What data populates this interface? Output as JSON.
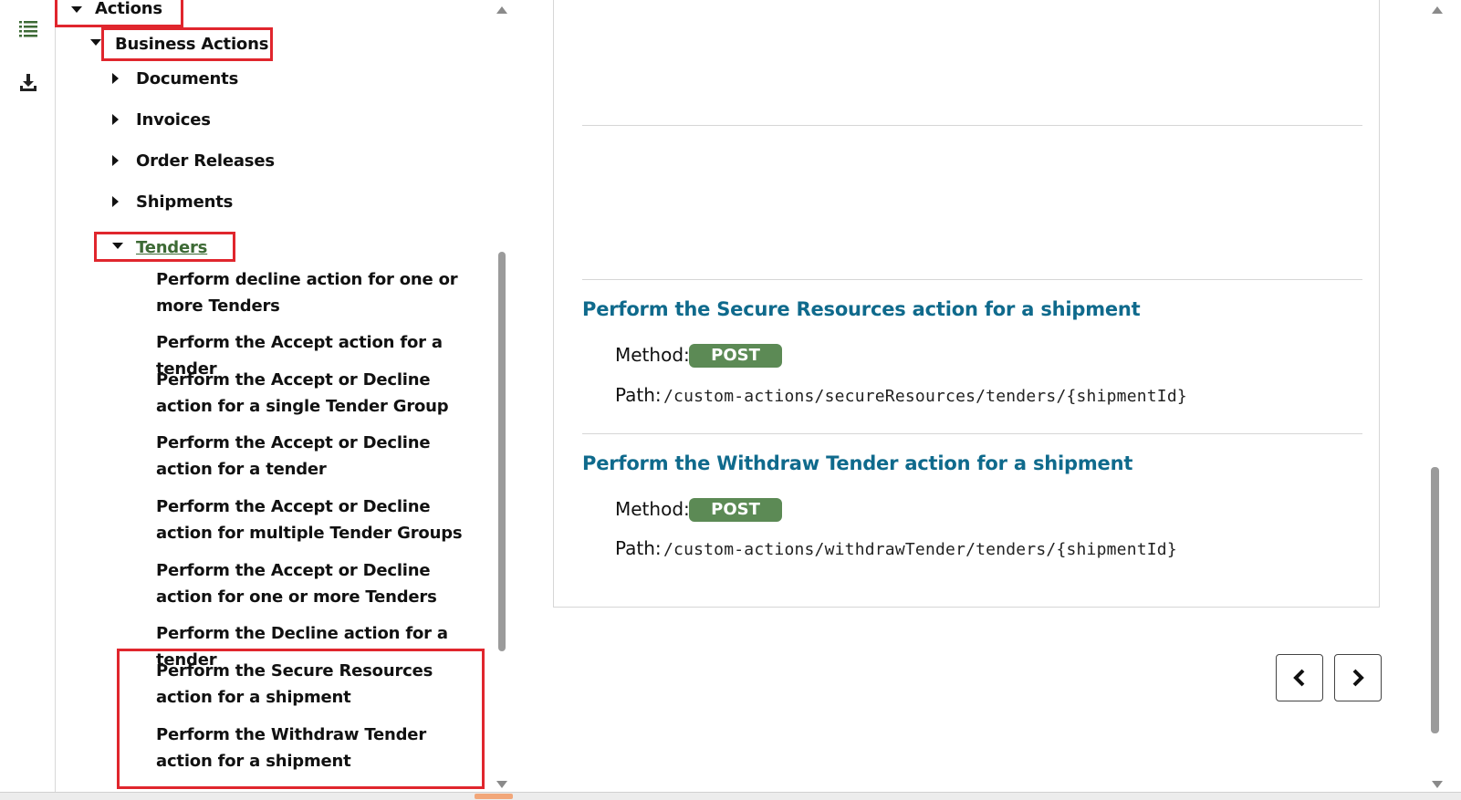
{
  "rail": {
    "icons": [
      "list-icon",
      "download-icon"
    ]
  },
  "tree": {
    "actions": "Actions",
    "business_actions": "Business Actions",
    "documents": "Documents",
    "invoices": "Invoices",
    "order_releases": "Order Releases",
    "shipments": "Shipments",
    "tenders": "Tenders",
    "leaves": [
      "Perform decline action for one or more Tenders",
      "Perform the Accept action for a tender",
      "Perform the Accept or Decline action for a single Tender Group",
      "Perform the Accept or Decline action for a tender",
      "Perform the Accept or Decline action for multiple Tender Groups",
      "Perform the Accept or Decline action for one or more Tenders",
      "Perform the Decline action for a tender",
      "Perform the Secure Resources action for a shipment",
      "Perform the Withdraw Tender action for a shipment"
    ]
  },
  "content": {
    "ops": [
      {
        "title": "Perform the Secure Resources action for a shipment",
        "method_label": "Method:",
        "method": "POST",
        "path_label": "Path:",
        "path": "/custom-actions/secureResources/tenders/{shipmentId}"
      },
      {
        "title": "Perform the Withdraw Tender action for a shipment",
        "method_label": "Method:",
        "method": "POST",
        "path_label": "Path:",
        "path": "/custom-actions/withdrawTender/tenders/{shipmentId}"
      }
    ]
  },
  "nav": {
    "prev": "previous-page-button",
    "next": "next-page-button"
  },
  "colors": {
    "highlight": "#e0262d",
    "link": "#0f6a8c",
    "post_badge": "#5c8a55",
    "tenders_link": "#3d6a35"
  }
}
